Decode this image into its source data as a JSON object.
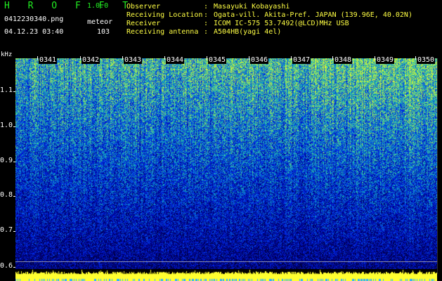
{
  "header": {
    "title": "H R O F F T",
    "version": "1.0.0",
    "filename": "0412230340.png",
    "mode": "meteor",
    "datetime": "04.12.23 03:40",
    "count": "103"
  },
  "info": [
    {
      "label": "Observer",
      "value": "Masayuki Kobayashi"
    },
    {
      "label": "Receiving Location",
      "value": "Ogata-vill. Akita-Pref. JAPAN (139.96E, 40.02N)"
    },
    {
      "label": "Receiver",
      "value": "ICOM IC-575 53.7492(@LCD)MHz USB"
    },
    {
      "label": "Receiving antenna",
      "value": "A504HB(yagi 4el)"
    }
  ],
  "spectrogram": {
    "y_unit": "kHz",
    "y_ticks": [
      "1.1",
      "1.0",
      "0.9",
      "0.8",
      "0.7",
      "0.6"
    ],
    "time_ticks": [
      "0341",
      "0342",
      "0343",
      "0344",
      "0345",
      "0346",
      "0347",
      "0348",
      "0349",
      "0350"
    ],
    "colors": {
      "low": "#000060",
      "mid": "#2050ff",
      "high": "#40d0a0",
      "peak": "#ffff30"
    }
  }
}
